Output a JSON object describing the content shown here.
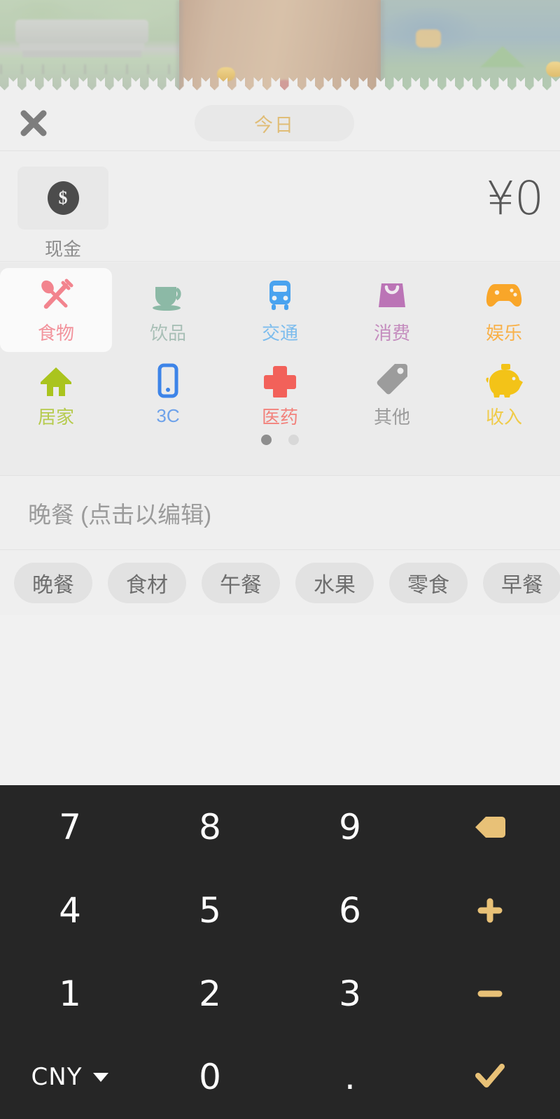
{
  "app": {
    "background_scene": "blurred-game-map",
    "sheet_color": "#efefef",
    "accent_color": "#e8c177"
  },
  "topbar": {
    "close_icon": "close-x-icon",
    "date_label": "今日",
    "date_label_color": "#e0bd77"
  },
  "entry": {
    "account_icon": "coin-dollar-icon",
    "account_label": "现金",
    "amount_display": "¥0",
    "currency_symbol": "¥",
    "amount_value": "0"
  },
  "categories": {
    "selected": "食物",
    "items": [
      {
        "label": "食物",
        "icon": "fork-spoon-icon",
        "color": "#f2848e",
        "selected": true
      },
      {
        "label": "饮品",
        "icon": "coffee-cup-icon",
        "color": "#8cb9a6",
        "selected": false
      },
      {
        "label": "交通",
        "icon": "bus-icon",
        "color": "#4aa3ef",
        "selected": false
      },
      {
        "label": "消费",
        "icon": "shopping-bag-icon",
        "color": "#bb74b6",
        "selected": false
      },
      {
        "label": "娱乐",
        "icon": "gamepad-icon",
        "color": "#f9a629",
        "selected": false
      },
      {
        "label": "居家",
        "icon": "house-icon",
        "color": "#aac41e",
        "selected": false
      },
      {
        "label": "3C",
        "icon": "smartphone-icon",
        "color": "#3d84e8",
        "selected": false
      },
      {
        "label": "医药",
        "icon": "medical-cross-icon",
        "color": "#f2615a",
        "selected": false
      },
      {
        "label": "其他",
        "icon": "price-tag-icon",
        "color": "#9c9c9c",
        "selected": false
      },
      {
        "label": "收入",
        "icon": "piggy-bank-icon",
        "color": "#f3c318",
        "selected": false
      }
    ],
    "pages": 2,
    "current_page": 1
  },
  "note": {
    "text": "晚餐 (点击以编辑)",
    "value": "晚餐",
    "hint": "(点击以编辑)"
  },
  "tags": [
    "晚餐",
    "食材",
    "午餐",
    "水果",
    "零食",
    "早餐"
  ],
  "keypad": {
    "currency_label": "CNY",
    "currency_caret_icon": "caret-down-icon",
    "keys": [
      {
        "label": "7",
        "type": "digit"
      },
      {
        "label": "8",
        "type": "digit"
      },
      {
        "label": "9",
        "type": "digit"
      },
      {
        "label": "",
        "type": "backspace",
        "icon": "backspace-icon"
      },
      {
        "label": "4",
        "type": "digit"
      },
      {
        "label": "5",
        "type": "digit"
      },
      {
        "label": "6",
        "type": "digit"
      },
      {
        "label": "+",
        "type": "operator",
        "icon": "plus-icon"
      },
      {
        "label": "1",
        "type": "digit"
      },
      {
        "label": "2",
        "type": "digit"
      },
      {
        "label": "3",
        "type": "digit"
      },
      {
        "label": "−",
        "type": "operator",
        "icon": "minus-icon"
      },
      {
        "label": "CNY",
        "type": "currency",
        "icon": "caret-down-icon"
      },
      {
        "label": "0",
        "type": "digit"
      },
      {
        "label": ".",
        "type": "decimal"
      },
      {
        "label": "",
        "type": "confirm",
        "icon": "checkmark-icon"
      }
    ]
  }
}
